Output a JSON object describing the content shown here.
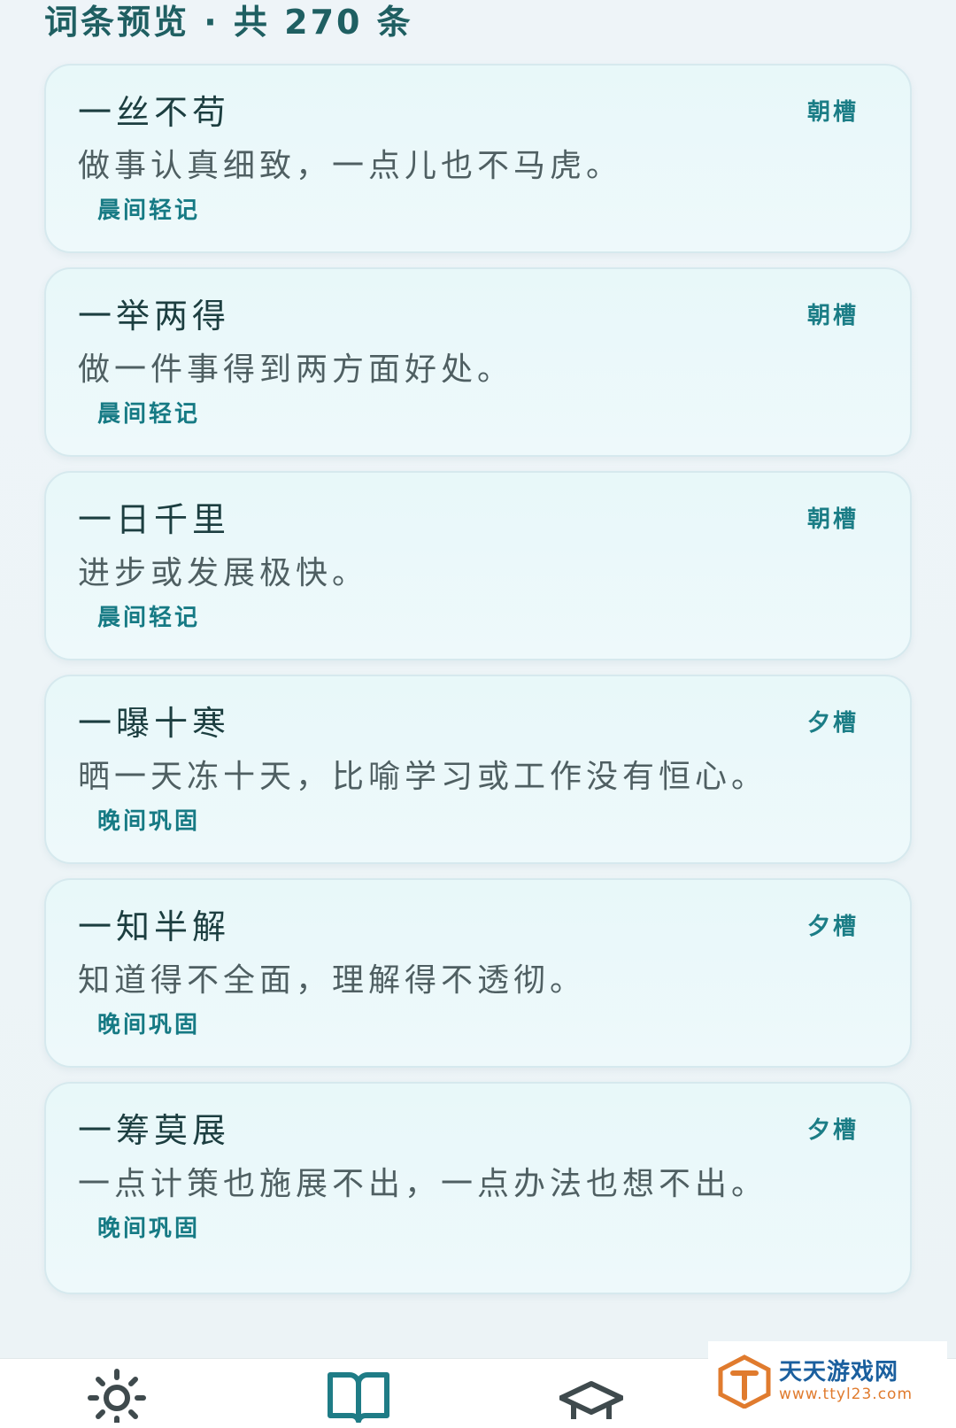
{
  "header": {
    "title": "词条预览 · 共 270 条"
  },
  "entries": [
    {
      "term": "一丝不苟",
      "slot": "朝槽",
      "meaning": "做事认真细致，一点儿也不马虎。",
      "tag": "晨间轻记"
    },
    {
      "term": "一举两得",
      "slot": "朝槽",
      "meaning": "做一件事得到两方面好处。",
      "tag": "晨间轻记"
    },
    {
      "term": "一日千里",
      "slot": "朝槽",
      "meaning": "进步或发展极快。",
      "tag": "晨间轻记"
    },
    {
      "term": "一曝十寒",
      "slot": "夕槽",
      "meaning": "晒一天冻十天，比喻学习或工作没有恒心。",
      "tag": "晚间巩固"
    },
    {
      "term": "一知半解",
      "slot": "夕槽",
      "meaning": "知道得不全面，理解得不透彻。",
      "tag": "晚间巩固"
    },
    {
      "term": "一筹莫展",
      "slot": "夕槽",
      "meaning": "一点计策也施展不出，一点办法也想不出。",
      "tag": "晚间巩固"
    }
  ],
  "tab_bar": {
    "tabs": [
      {
        "icon": "sun-icon",
        "color": "#3f4a4d"
      },
      {
        "icon": "book-icon",
        "color": "#1f7c86"
      },
      {
        "icon": "graduation-cap-icon",
        "color": "#3f4a4d"
      }
    ]
  },
  "watermark": {
    "name": "天天游戏网",
    "url": "www.ttyl23.com",
    "logo_color": "#e07b2e",
    "text_color": "#1a5f9e"
  }
}
